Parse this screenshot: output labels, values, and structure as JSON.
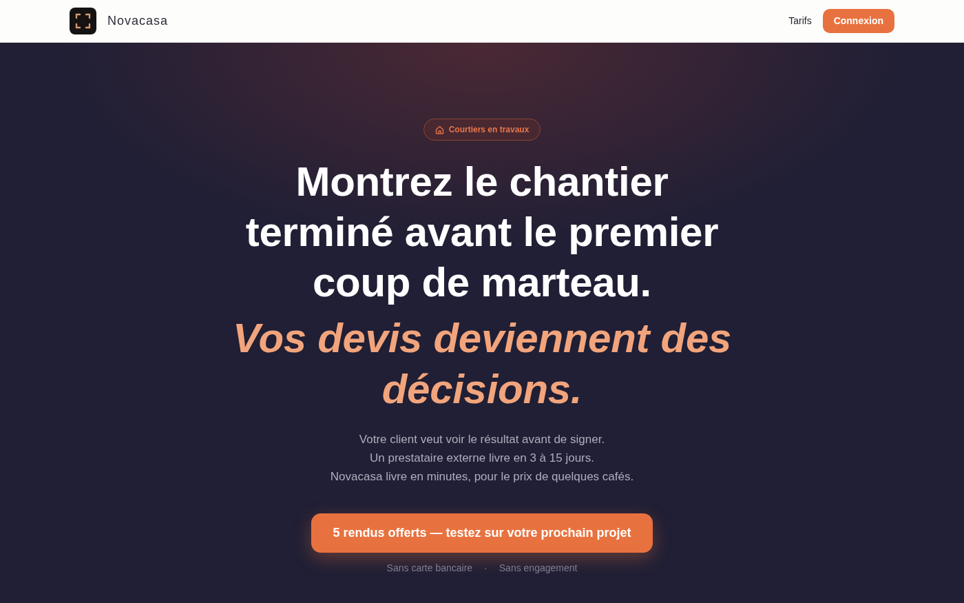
{
  "navbar": {
    "brand": "Novacasa",
    "links": [
      {
        "label": "Tarifs",
        "kind": "link"
      },
      {
        "label": "Connexion",
        "kind": "button"
      }
    ]
  },
  "hero": {
    "badge": "Courtiers en travaux",
    "headline": "Montrez le chantier terminé avant le premier coup de marteau.",
    "tagline": "Vos devis deviennent des décisions.",
    "intro_lines": [
      "Votre client veut voir le résultat avant de signer.",
      "Un prestataire externe livre en 3 à 15 jours.",
      "Novacasa livre en minutes, pour le prix de quelques cafés."
    ],
    "cta": "5 rendus offerts — testez sur votre prochain projet",
    "notes": [
      "Sans carte bancaire",
      "Sans engagement"
    ],
    "note_separator": "·"
  }
}
